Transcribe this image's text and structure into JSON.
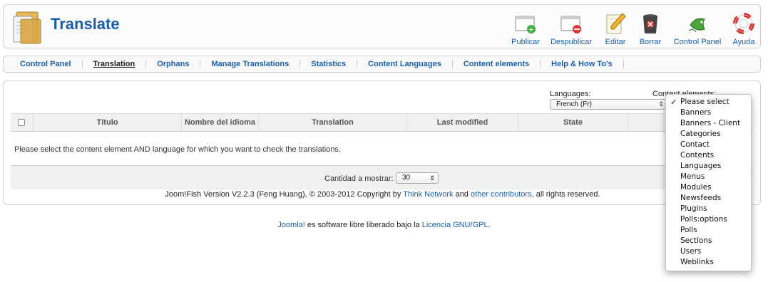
{
  "header": {
    "title": "Translate",
    "buttons": [
      {
        "label": "Publicar",
        "icon": "publish-icon"
      },
      {
        "label": "Despublicar",
        "icon": "unpublish-icon"
      },
      {
        "label": "Editar",
        "icon": "edit-icon"
      },
      {
        "label": "Borrar",
        "icon": "trash-icon"
      },
      {
        "label": "Control Panel",
        "icon": "joomfish-icon"
      },
      {
        "label": "Ayuda",
        "icon": "help-lifebuoy-icon"
      }
    ]
  },
  "submenu": {
    "items": [
      {
        "label": "Control Panel",
        "active": false
      },
      {
        "label": "Translation",
        "active": true
      },
      {
        "label": "Orphans",
        "active": false
      },
      {
        "label": "Manage Translations",
        "active": false
      },
      {
        "label": "Statistics",
        "active": false
      },
      {
        "label": "Content Languages",
        "active": false
      },
      {
        "label": "Content elements",
        "active": false
      },
      {
        "label": "Help & How To's",
        "active": false
      }
    ]
  },
  "filters": {
    "languages_label": "Languages:",
    "languages_value": "French (Fr)",
    "content_elements_label": "Content elements:"
  },
  "table": {
    "columns": [
      "Título",
      "Nombre del idioma",
      "Translation",
      "Last modified",
      "State"
    ],
    "empty_message": "Please select the content element AND language for which you want to check the translations."
  },
  "pagination": {
    "count_label": "Cantidad a mostrar:",
    "count_value": "30"
  },
  "copyright": {
    "prefix": "Joom!Fish Version V2.2.3 (Feng Huang), © 2003-2012 Copyright by ",
    "link1": "Think Network",
    "middle": " and ",
    "link2": "other contributors",
    "suffix": ", all rights reserved."
  },
  "license": {
    "link1": "Joomla!",
    "middle": " es software libre liberado bajo la ",
    "link2": "Licencia GNU/GPL",
    "suffix": "."
  },
  "dropdown": {
    "selected": "Please select",
    "options": [
      "Please select",
      "Banners",
      "Banners - Client",
      "Categories",
      "Contact",
      "Contents",
      "Languages",
      "Menus",
      "Modules",
      "Newsfeeds",
      "Plugins",
      "Polls:options",
      "Polls",
      "Sections",
      "Users",
      "Weblinks"
    ]
  }
}
